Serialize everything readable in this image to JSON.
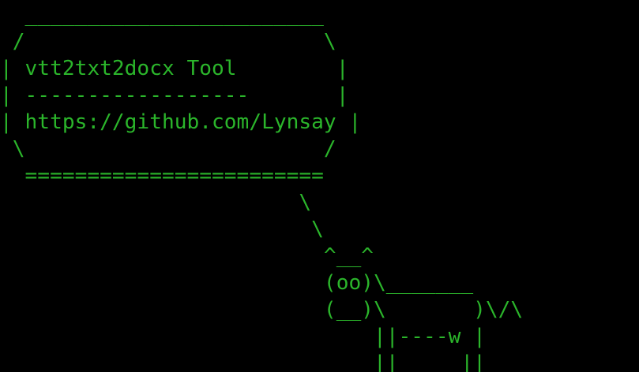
{
  "terminal": {
    "text_color": "#2bb52b",
    "background_color": "#000000",
    "lines": [
      "  ________________________",
      " /                        \\",
      "| vtt2txt2docx Tool        |",
      "| ------------------       |",
      "| https://github.com/Lynsay |",
      " \\                        /",
      "  ========================",
      "                        \\",
      "                         \\",
      "                          ^__^",
      "                          (oo)\\_______",
      "                          (__)\\       )\\/\\",
      "                              ||----w |",
      "                              ||     ||"
    ]
  }
}
